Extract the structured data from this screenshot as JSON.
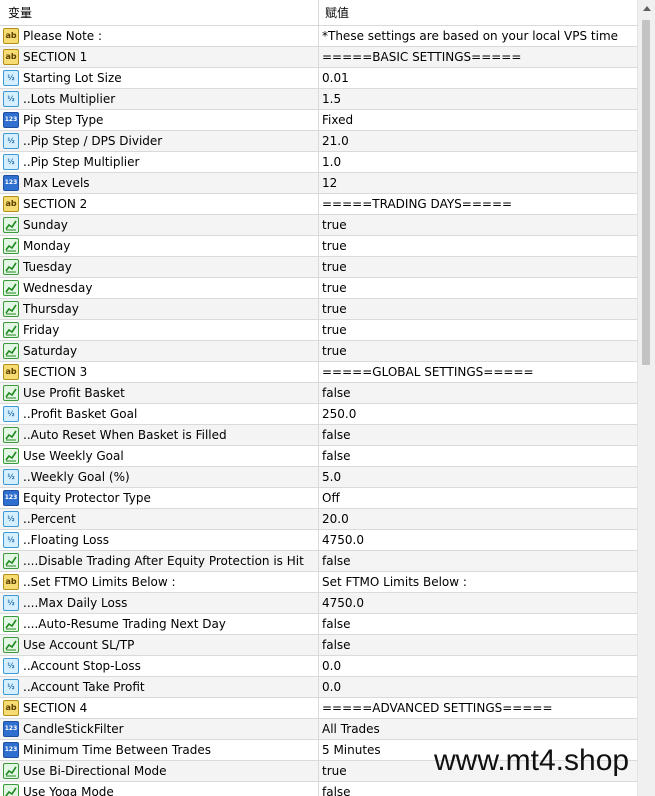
{
  "header": {
    "col_variable": "变量",
    "col_value": "赋值"
  },
  "rows": [
    {
      "icon": "string",
      "name": "Please Note :",
      "value": "*These settings are based on your local VPS time"
    },
    {
      "icon": "string",
      "name": "SECTION 1",
      "value": "=====BASIC SETTINGS====="
    },
    {
      "icon": "double",
      "name": "Starting Lot Size",
      "value": "0.01"
    },
    {
      "icon": "double",
      "name": "..Lots Multiplier",
      "value": "1.5"
    },
    {
      "icon": "int",
      "name": "Pip Step Type",
      "value": "Fixed"
    },
    {
      "icon": "double",
      "name": "..Pip Step / DPS Divider",
      "value": "21.0"
    },
    {
      "icon": "double",
      "name": "..Pip Step Multiplier",
      "value": "1.0"
    },
    {
      "icon": "int",
      "name": "Max Levels",
      "value": "12"
    },
    {
      "icon": "string",
      "name": "SECTION 2",
      "value": "=====TRADING DAYS====="
    },
    {
      "icon": "bool",
      "name": "Sunday",
      "value": "true"
    },
    {
      "icon": "bool",
      "name": "Monday",
      "value": "true"
    },
    {
      "icon": "bool",
      "name": "Tuesday",
      "value": "true"
    },
    {
      "icon": "bool",
      "name": "Wednesday",
      "value": "true"
    },
    {
      "icon": "bool",
      "name": "Thursday",
      "value": "true"
    },
    {
      "icon": "bool",
      "name": "Friday",
      "value": "true"
    },
    {
      "icon": "bool",
      "name": "Saturday",
      "value": "true"
    },
    {
      "icon": "string",
      "name": "SECTION 3",
      "value": "=====GLOBAL SETTINGS====="
    },
    {
      "icon": "bool",
      "name": "Use Profit Basket",
      "value": "false"
    },
    {
      "icon": "double",
      "name": "..Profit Basket Goal",
      "value": "250.0"
    },
    {
      "icon": "bool",
      "name": "..Auto Reset When Basket is Filled",
      "value": "false"
    },
    {
      "icon": "bool",
      "name": "Use Weekly Goal",
      "value": "false"
    },
    {
      "icon": "double",
      "name": "..Weekly Goal (%)",
      "value": "5.0"
    },
    {
      "icon": "int",
      "name": "Equity Protector Type",
      "value": "Off"
    },
    {
      "icon": "double",
      "name": "..Percent",
      "value": "20.0"
    },
    {
      "icon": "double",
      "name": "..Floating Loss",
      "value": "4750.0"
    },
    {
      "icon": "bool",
      "name": "....Disable Trading After Equity Protection is Hit",
      "value": "false"
    },
    {
      "icon": "string",
      "name": "..Set FTMO Limits Below :",
      "value": "Set FTMO Limits Below :"
    },
    {
      "icon": "double",
      "name": "....Max Daily Loss",
      "value": "4750.0"
    },
    {
      "icon": "bool",
      "name": "....Auto-Resume Trading Next Day",
      "value": "false"
    },
    {
      "icon": "bool",
      "name": "Use Account SL/TP",
      "value": "false"
    },
    {
      "icon": "double",
      "name": "..Account Stop-Loss",
      "value": "0.0"
    },
    {
      "icon": "double",
      "name": "..Account Take Profit",
      "value": "0.0"
    },
    {
      "icon": "string",
      "name": "SECTION 4",
      "value": "=====ADVANCED SETTINGS====="
    },
    {
      "icon": "int",
      "name": "CandleStickFilter",
      "value": "All Trades"
    },
    {
      "icon": "int",
      "name": "Minimum Time Between Trades",
      "value": "5 Minutes"
    },
    {
      "icon": "bool",
      "name": "Use Bi-Directional Mode",
      "value": "true"
    },
    {
      "icon": "bool",
      "name": "Use Yoga Mode",
      "value": "false"
    }
  ],
  "watermark": "www.mt4.shop"
}
